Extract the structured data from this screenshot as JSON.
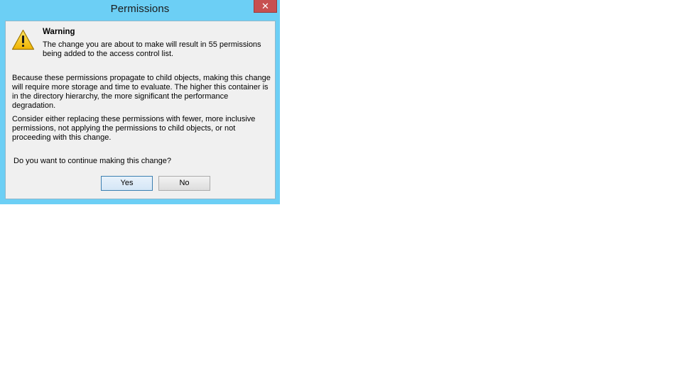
{
  "dialog": {
    "title": "Permissions",
    "close_label": "✕",
    "icon": "warning-icon",
    "warning_heading": "Warning",
    "warning_text": "The change you are about to make will result in 55 permissions being added to the access control list.",
    "paragraph_1": "Because these permissions propagate to child objects, making this change will require more storage and time to evaluate. The higher this container is in the directory hierarchy, the more significant the performance degradation.",
    "paragraph_2": "Consider either replacing these permissions with fewer, more inclusive permissions, not applying the permissions to child objects, or not proceeding with this change.",
    "question": "Do you want to continue making this change?",
    "buttons": {
      "yes": "Yes",
      "no": "No"
    }
  },
  "colors": {
    "frame": "#6ccff5",
    "close_button": "#c75050",
    "client_background": "#f0f0f0",
    "warning_icon": "#f5c400"
  }
}
